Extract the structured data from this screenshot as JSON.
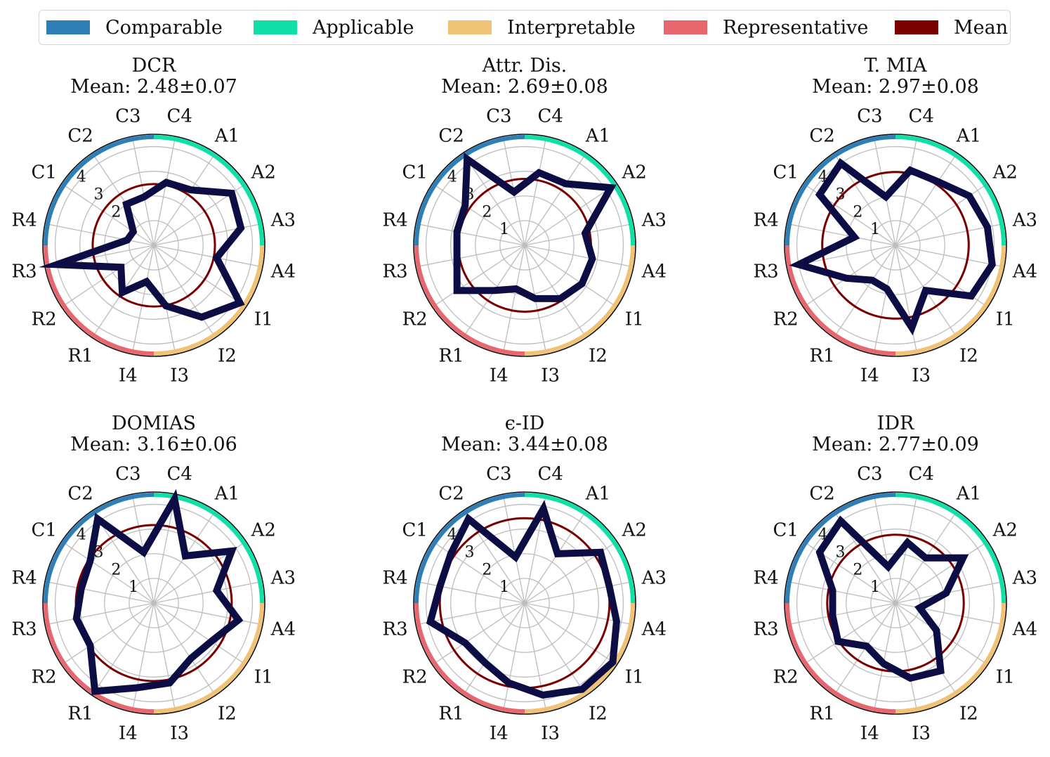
{
  "legend": [
    {
      "label": "Comparable",
      "color": "#2e7fb8"
    },
    {
      "label": "Applicable",
      "color": "#0fe0a8"
    },
    {
      "label": "Interpretable",
      "color": "#f0c275"
    },
    {
      "label": "Representative",
      "color": "#e8676e"
    },
    {
      "label": "Mean",
      "color": "#7a0000"
    }
  ],
  "chart_data": {
    "type": "radar",
    "axes": [
      "C4",
      "A1",
      "A2",
      "A3",
      "A4",
      "I1",
      "I2",
      "I3",
      "I4",
      "R1",
      "R2",
      "R3",
      "R4",
      "C1",
      "C2",
      "C3"
    ],
    "radial_ticks": [
      "1",
      "2",
      "3",
      "4"
    ],
    "rmax": 4.5,
    "series_color": "#0d0d45",
    "mean_color": "#7a0000",
    "category_colors": {
      "Comparable": "#2e7fb8",
      "Applicable": "#0fe0a8",
      "Interpretable": "#f0c275",
      "Representative": "#e8676e"
    },
    "panels": [
      {
        "title": "DCR",
        "subtitle": "Mean: 2.48±0.07",
        "mean": 2.48,
        "values": [
          2.6,
          2.7,
          3.8,
          3.6,
          2.6,
          4.2,
          3.5,
          2.5,
          1.5,
          2.3,
          1.6,
          4.0,
          1.1,
          1.0,
          2.0,
          2.0
        ]
      },
      {
        "title": "Attr. Dis.",
        "subtitle": "Mean: 2.69±0.08",
        "mean": 2.69,
        "values": [
          3.0,
          3.0,
          4.2,
          2.5,
          2.8,
          2.8,
          2.6,
          2.2,
          1.8,
          2.2,
          3.3,
          2.8,
          2.8,
          2.9,
          4.2,
          2.2
        ]
      },
      {
        "title": "T. MIA",
        "subtitle": "Mean: 2.97±0.08",
        "mean": 2.97,
        "values": [
          3.1,
          3.1,
          3.6,
          3.8,
          4.0,
          3.7,
          2.2,
          3.4,
          1.8,
          1.7,
          2.4,
          4.0,
          1.7,
          3.7,
          4.0,
          2.0
        ]
      },
      {
        "title": "DOMIAS",
        "subtitle": "Mean: 3.16±0.06",
        "mean": 3.16,
        "values": [
          4.3,
          2.3,
          3.8,
          2.6,
          3.5,
          2.8,
          2.7,
          3.3,
          3.5,
          4.3,
          3.1,
          3.2,
          3.0,
          3.1,
          4.1,
          2.1
        ]
      },
      {
        "title": "ϵ-ID",
        "subtitle": "Mean: 3.44±0.08",
        "mean": 3.44,
        "values": [
          3.9,
          2.4,
          3.7,
          3.5,
          3.8,
          4.3,
          4.2,
          3.8,
          3.3,
          2.9,
          2.9,
          3.9,
          3.5,
          3.6,
          4.1,
          1.9
        ]
      },
      {
        "title": "IDR",
        "subtitle": "Mean: 2.77±0.09",
        "mean": 2.77,
        "values": [
          2.5,
          2.2,
          3.3,
          2.1,
          1.0,
          2.0,
          3.3,
          3.1,
          2.5,
          2.1,
          2.8,
          2.6,
          2.6,
          3.7,
          4.0,
          1.5
        ]
      }
    ]
  }
}
